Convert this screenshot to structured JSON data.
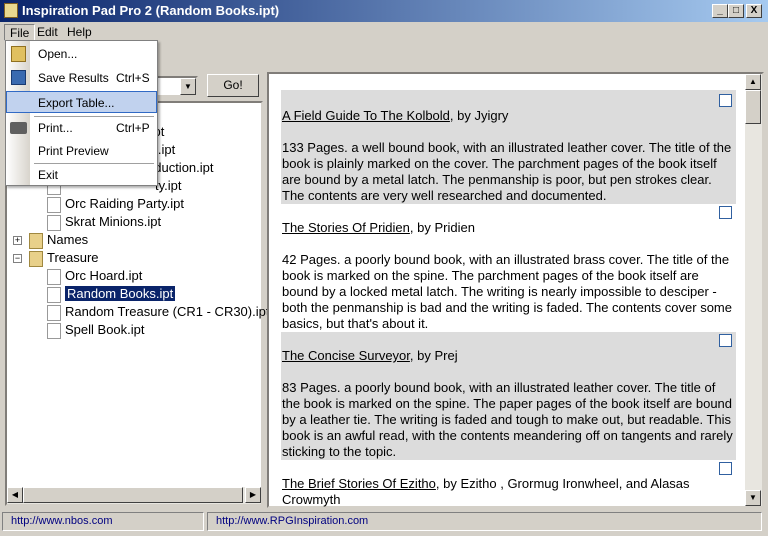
{
  "window": {
    "title": "Inspiration Pad Pro 2  (Random Books.ipt)",
    "controls": [
      "_",
      "□",
      "X"
    ]
  },
  "menubar": [
    "File",
    "Edit",
    "Help"
  ],
  "file_menu": [
    {
      "label": "Open...",
      "icon": "open-folder-icon",
      "shortcut": ""
    },
    {
      "label": "Save Results",
      "icon": "floppy-disk-icon",
      "shortcut": "Ctrl+S"
    },
    {
      "label": "Export Table...",
      "icon": "",
      "shortcut": "",
      "highlighted": true
    },
    {
      "label": "Print...",
      "icon": "printer-icon",
      "shortcut": "Ctrl+P"
    },
    {
      "label": "Print Preview",
      "icon": "",
      "shortcut": ""
    },
    {
      "label": "Exit",
      "icon": "",
      "shortcut": ""
    }
  ],
  "toolbar": {
    "go_label": "Go!"
  },
  "tree": {
    "partial_items": [
      ".ipt",
      "et.ipt",
      "oduction.ipt",
      "ty.ipt"
    ],
    "items": [
      {
        "label": "Orc Raiding Party.ipt",
        "type": "file"
      },
      {
        "label": "Skrat Minions.ipt",
        "type": "file"
      },
      {
        "label": "Names",
        "type": "folder",
        "expanded": false
      },
      {
        "label": "Treasure",
        "type": "folder",
        "expanded": true
      },
      {
        "label": "Orc Hoard.ipt",
        "type": "file"
      },
      {
        "label": "Random Books.ipt",
        "type": "file",
        "selected": true
      },
      {
        "label": "Random Treasure (CR1 - CR30).ipt",
        "type": "file"
      },
      {
        "label": "Spell Book.ipt",
        "type": "file"
      }
    ]
  },
  "results": [
    {
      "title": "A Field Guide To The Kolbold",
      "by": ", by Jyigry",
      "body": "133 Pages. a well bound book, with an illustrated leather cover. The title of the book is plainly marked on the cover. The parchment pages of the book itself are bound by a metal latch. The penmanship is poor, but pen strokes clear. The contents are very well researched and documented."
    },
    {
      "title": "The Stories Of Pridien",
      "by": ", by Pridien",
      "body": "42 Pages. a poorly bound book, with an illustrated brass cover. The title of the book is marked on the spine. The parchment pages of the book itself are bound by a locked metal latch. The writing is nearly impossible to desciper - both the penmanship is bad and the writing is faded. The contents cover some basics, but that's about it."
    },
    {
      "title": "The Concise Surveyor",
      "by": ", by Prej",
      "body": "83 Pages. a poorly bound book, with an illustrated leather cover. The title of the book is marked on the spine. The paper pages of the book itself are bound by a leather tie. The writing is faded and tough to make out, but readable. This book is an awful read, with the contents meandering off on tangents and rarely sticking to the topic."
    },
    {
      "title": "The Brief Stories Of Ezitho",
      "by": ", by Ezitho , Grormug Ironwheel, and Alasas Crowmyth",
      "body": ""
    }
  ],
  "status": {
    "left": "http://www.nbos.com",
    "right": "http://www.RPGInspiration.com"
  },
  "colors": {
    "title_start": "#0a246a",
    "selection": "#0a246a",
    "link": "#000080",
    "row_alt": "#dcdcdc"
  }
}
